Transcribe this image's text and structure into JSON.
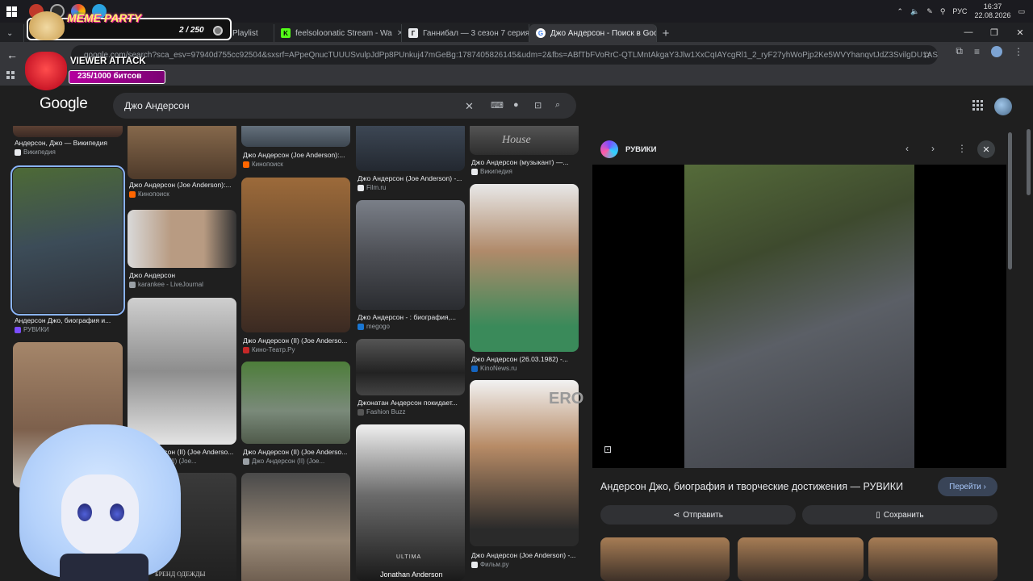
{
  "taskbar": {
    "tray_lang": "РУС",
    "clock_time": "16:37",
    "clock_date": "22.08.2026"
  },
  "tabs": [
    {
      "label": "Playlist",
      "favicon_color": "#3c4043",
      "favicon_text": ""
    },
    {
      "label": "feelsoloonatic Stream - Wa",
      "favicon_color": "#53fc18",
      "favicon_text": "K"
    },
    {
      "label": "Ганнибал — 3 сезон 7 серия",
      "favicon_color": "#e8eaed",
      "favicon_text": "Г"
    },
    {
      "label": "Джо Андерсон - Поиск в Goo",
      "favicon_color": "#4285f4",
      "favicon_text": "G"
    }
  ],
  "address_bar": {
    "url": "google.com/search?sca_esv=97940d755cc92504&sxsrf=APpeQnucTUUUSvulpJdPp8PUnkuj47mGeBg:1787405826145&udm=2&fbs=ABfTbFVoRrC-QTLMntAkgaY3Jlw1XxCqIAYcgRl1_2_ryF27yhWoPjp2Ke5WVYhanqvtJdZ3SvilgDU1ASO0McKqiVD5mPc..."
  },
  "google": {
    "logo": "Google",
    "query": "Джо Андерсон"
  },
  "overlay": {
    "meme_title": "MEME PARTY",
    "meme_count": "2 / 250",
    "viewer_attack_title": "VIEWER ATTACK",
    "viewer_attack_count": "235/1000 битсов",
    "viewer_attack_progress": 0.235
  },
  "grid": {
    "col1": [
      {
        "caption": "Андерсон, Джо — Википедия",
        "source": "Википедия",
        "src_color": "#e8eaed"
      },
      {
        "caption": "Андерсон Джо, биография и...",
        "source": "РУВИКИ",
        "src_color": "#7b4dff",
        "selected": true
      },
      {
        "caption": "",
        "source": "",
        "src_color": "#1f1f1f"
      }
    ],
    "col2": [
      {
        "caption": "Джо Андерсон (Joe Anderson):...",
        "source": "Кинопоиск",
        "src_color": "#ff6600"
      },
      {
        "caption": "Джо Андерсон",
        "source": "karankee - LiveJournal",
        "src_color": "#9aa0a6"
      },
      {
        "caption": "Джо Андерсон (II) (Joe Anderso...",
        "source": "Андерсон (II) (Joe...",
        "src_color": "#9aa0a6"
      },
      {
        "caption": "",
        "source": "",
        "src_color": "#1f1f1f",
        "overlay_text": "БРЕНД ОДЕЖДЫ"
      }
    ],
    "col3": [
      {
        "caption": "Джо Андерсон (Joe Anderson):...",
        "source": "Кинопоиск",
        "src_color": "#ff6600"
      },
      {
        "caption": "Джо Андерсон (II) (Joe Anderso...",
        "source": "Кино-Театр.Ру",
        "src_color": "#c62828"
      },
      {
        "caption": "Джо Андерсон (II) (Joe Anderso...",
        "source": "Джо Андерсон (II) (Joe...",
        "src_color": "#9aa0a6"
      },
      {
        "caption": "",
        "source": "",
        "src_color": "#1f1f1f"
      }
    ],
    "col4": [
      {
        "caption": "Джо Андерсон (Joe Anderson) -...",
        "source": "Film.ru",
        "src_color": "#e8eaed"
      },
      {
        "caption": "Джо Андерсон - : биография,...",
        "source": "megogo",
        "src_color": "#1976d2"
      },
      {
        "caption": "Джонатан Андерсон покидает...",
        "source": "Fashion Buzz",
        "src_color": "#333"
      },
      {
        "caption": "",
        "source": "",
        "src_color": "#1f1f1f",
        "overlay_text": "Jonathan Anderson",
        "overlay_text2": "ULTIMA"
      }
    ],
    "col5": [
      {
        "caption": "Джо Андерсон (музыкант) —...",
        "source": "Википедия",
        "src_color": "#e8eaed",
        "overlay_text": "House"
      },
      {
        "caption": "Джо Андерсон (26.03.1982) -...",
        "source": "KinoNews.ru",
        "src_color": "#1565c0"
      },
      {
        "caption": "Джо Андерсон (Joe Anderson) -...",
        "source": "Фильм.ру",
        "src_color": "#e8eaed",
        "overlay_text": "ERO"
      }
    ]
  },
  "preview": {
    "site": "РУВИКИ",
    "title": "Андерсон Джо, биография и творческие достижения — РУВИКИ",
    "go_label": "Перейти",
    "share_label": "Отправить",
    "save_label": "Сохранить"
  },
  "icons": {
    "close": "✕",
    "prev": "‹",
    "next": "›",
    "more": "⋮",
    "search": "⌕",
    "mic": "🎙"
  }
}
